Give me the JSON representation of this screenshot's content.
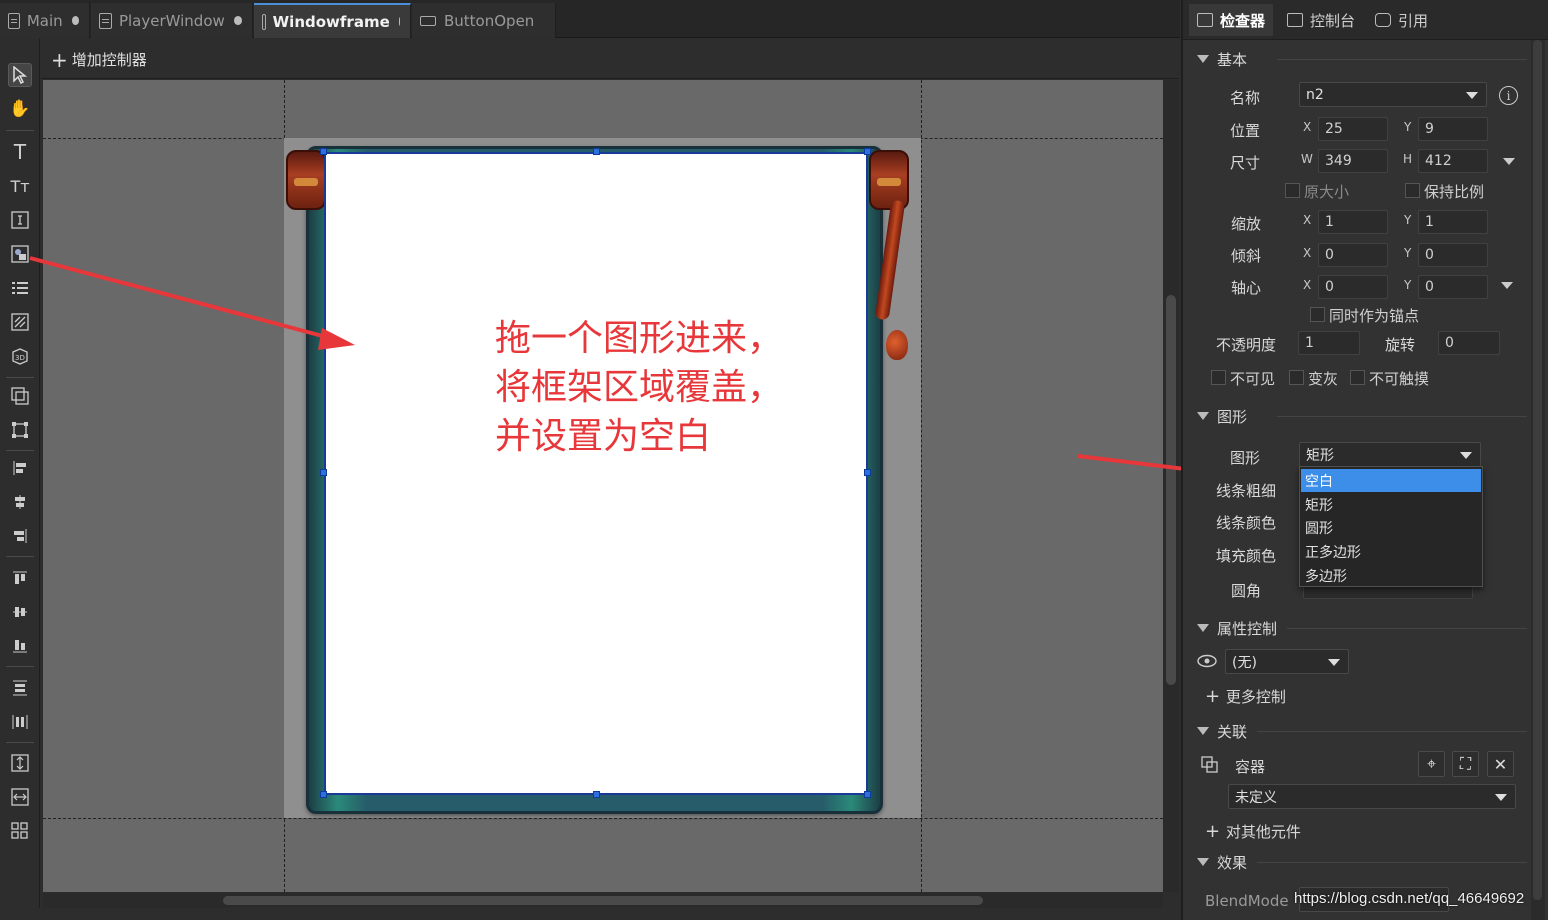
{
  "tabs": [
    {
      "label": "Main",
      "modified": true
    },
    {
      "label": "PlayerWindow",
      "modified": true
    },
    {
      "label": "Windowframe",
      "modified": true,
      "active": true
    },
    {
      "label": "ButtonOpen",
      "modified": false
    }
  ],
  "toolbar": {
    "add_controller": "增加控制器"
  },
  "left_tools": [
    "pointer-icon",
    "hand-icon",
    "text-icon",
    "rich-text-icon",
    "input-text-icon",
    "image-icon",
    "list-icon",
    "loader-icon",
    "3d-icon",
    "component-icon",
    "transform-icon",
    "align-left-icon",
    "align-center-h-icon",
    "align-right-icon",
    "align-top-icon",
    "align-middle-v-icon",
    "align-bottom-icon",
    "distribute-v-icon",
    "distribute-h-icon",
    "same-height-icon",
    "same-width-icon",
    "grid-icon"
  ],
  "annotation": {
    "lines": [
      "拖一个图形进来，",
      "将框架区域覆盖，",
      "并设置为空白"
    ],
    "color": "#e8373a"
  },
  "inspector": {
    "tabs": [
      "检查器",
      "控制台",
      "引用"
    ],
    "basic": {
      "title": "基本",
      "name_label": "名称",
      "name": "n2",
      "pos_label": "位置",
      "x": "25",
      "y": "9",
      "size_label": "尺寸",
      "w": "349",
      "h": "412",
      "original_size": "原大小",
      "keep_ratio": "保持比例",
      "scale_label": "缩放",
      "scale_x": "1",
      "scale_y": "1",
      "skew_label": "倾斜",
      "skew_x": "0",
      "skew_y": "0",
      "pivot_label": "轴心",
      "pivot_x": "0",
      "pivot_y": "0",
      "pivot_anchor": "同时作为锚点",
      "opacity_label": "不透明度",
      "opacity": "1",
      "rotation_label": "旋转",
      "rotation": "0",
      "invisible": "不可见",
      "grayed": "变灰",
      "untouchable": "不可触摸",
      "axis_x": "X",
      "axis_y": "Y",
      "axis_w": "W",
      "axis_h": "H"
    },
    "shape": {
      "title": "图形",
      "shape_label": "图形",
      "shape_value": "矩形",
      "line_width_label": "线条粗细",
      "line_color_label": "线条颜色",
      "fill_color_label": "填充颜色",
      "corner_label": "圆角",
      "options": [
        "空白",
        "矩形",
        "圆形",
        "正多边形",
        "多边形"
      ],
      "selected_option": "空白"
    },
    "gear": {
      "title": "属性控制",
      "value": "(无)",
      "more": "更多控制"
    },
    "relation": {
      "title": "关联",
      "container_label": "容器",
      "container_value": "未定义",
      "other": "对其他元件"
    },
    "effect": {
      "title": "效果",
      "blend_label": "BlendMode"
    }
  },
  "watermark": "https://blog.csdn.net/qq_46649692",
  "colors": {
    "accent": "#3d8ee8",
    "arrow": "#e8373a",
    "selection": "#2e6fe0"
  }
}
